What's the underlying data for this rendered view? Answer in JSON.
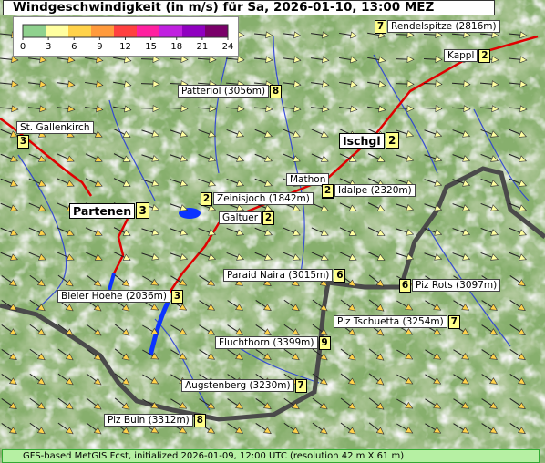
{
  "title": "Windgeschwindigkeit (in m/s) für Sa, 2026-01-10, 13:00 MEZ",
  "legend": {
    "ticks": [
      "0",
      "3",
      "6",
      "9",
      "12",
      "15",
      "18",
      "21",
      "24"
    ],
    "colors": [
      "#8fd18e",
      "#ffffa0",
      "#ffd24a",
      "#ff9a3c",
      "#ff4040",
      "#ff20a0",
      "#c020e0",
      "#9000c0",
      "#7a006a"
    ]
  },
  "labels": [
    {
      "id": "rendelspitze",
      "name": "Rendelspitze (2816m)",
      "value": "7"
    },
    {
      "id": "kappl",
      "name": "Kappl",
      "value": "2"
    },
    {
      "id": "patteriol",
      "name": "Patteriol (3056m)",
      "value": "8"
    },
    {
      "id": "st-gallenkirch",
      "name": "St. Gallenkirch",
      "value": "3"
    },
    {
      "id": "ischgl",
      "name": "Ischgl",
      "value": "2"
    },
    {
      "id": "mathon",
      "name": "Mathon",
      "value": "2"
    },
    {
      "id": "idalpe",
      "name": "Idalpe (2320m)",
      "value": "2"
    },
    {
      "id": "zeinisjoch",
      "name": "Zeinisjoch (1842m)",
      "value": "2"
    },
    {
      "id": "partenen",
      "name": "Partenen",
      "value": "3"
    },
    {
      "id": "galtuer",
      "name": "Galtuer",
      "value": "2"
    },
    {
      "id": "paraid-naira",
      "name": "Paraid Naira (3015m)",
      "value": "6"
    },
    {
      "id": "piz-rots",
      "name": "Piz Rots (3097m)",
      "value": "6"
    },
    {
      "id": "bieler-hoehe",
      "name": "Bieler Hoehe (2036m)",
      "value": "3"
    },
    {
      "id": "piz-tschuetta",
      "name": "Piz Tschuetta (3254m)",
      "value": "7"
    },
    {
      "id": "fluchthorn",
      "name": "Fluchthorn (3399m)",
      "value": "9"
    },
    {
      "id": "augstenberg",
      "name": "Augstenberg (3230m)",
      "value": "7"
    },
    {
      "id": "piz-buin",
      "name": "Piz Buin (3312m)",
      "value": "8"
    }
  ],
  "footer": "GFS-based MetGIS Fcst, initialized 2026-01-09, 12:00 UTC  (resolution 42 m X 61 m)"
}
